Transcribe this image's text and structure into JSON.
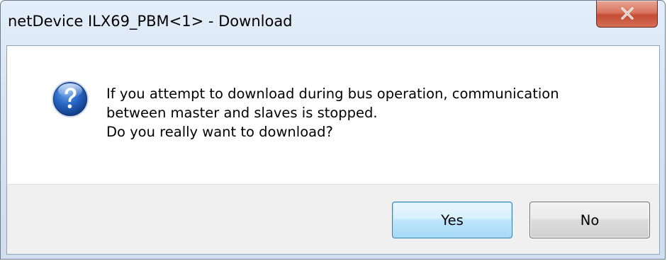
{
  "dialog": {
    "title": "netDevice ILX69_PBM<1> - Download",
    "icon": "question-icon",
    "message_lines": [
      "If you attempt to download during bus operation, communication",
      "between master and slaves is stopped.",
      "Do you really want to download?"
    ],
    "buttons": {
      "yes_label": "Yes",
      "no_label": "No"
    },
    "close_icon": "close-icon"
  },
  "colors": {
    "window_frame": "#d6e4f3",
    "close_button": "#c44d35",
    "default_button_border": "#3c7fb1",
    "footer_background": "#f0f0f0"
  }
}
